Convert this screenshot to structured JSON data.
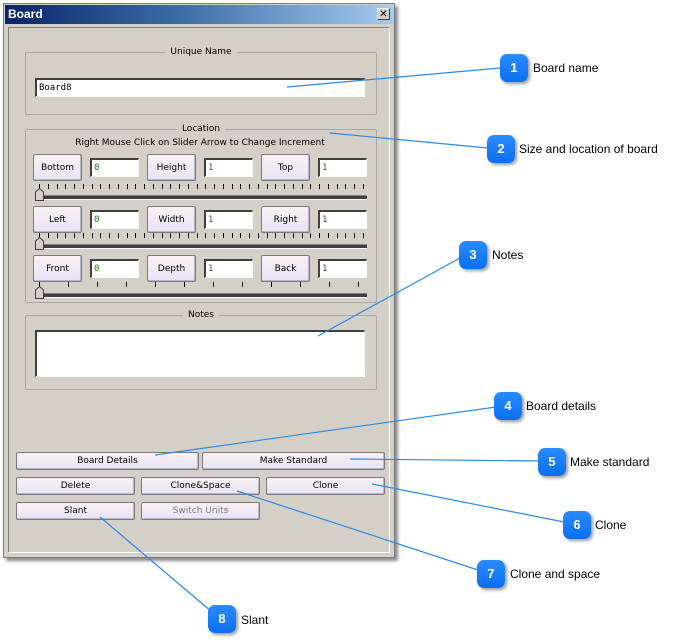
{
  "window": {
    "title": "Board",
    "close_icon": "close-icon"
  },
  "unique_name": {
    "group_label": "Unique Name",
    "value": "Board8"
  },
  "location": {
    "group_label": "Location",
    "hint": "Right Mouse Click on Slider Arrow to Change Increment",
    "rows": [
      {
        "fields": [
          {
            "label": "Bottom",
            "value": "0"
          },
          {
            "label": "Height",
            "value": "1"
          },
          {
            "label": "Top",
            "value": "1"
          }
        ],
        "slider_value": 0
      },
      {
        "fields": [
          {
            "label": "Left",
            "value": "0"
          },
          {
            "label": "Width",
            "value": "1"
          },
          {
            "label": "Right",
            "value": "1"
          }
        ],
        "slider_value": 0
      },
      {
        "fields": [
          {
            "label": "Front",
            "value": "0"
          },
          {
            "label": "Depth",
            "value": "1"
          },
          {
            "label": "Back",
            "value": "1"
          }
        ],
        "slider_value": 0
      }
    ]
  },
  "notes": {
    "group_label": "Notes",
    "value": ""
  },
  "buttons": {
    "board_details": "Board Details",
    "make_standard": "Make Standard",
    "delete": "Delete",
    "clone_space": "Clone&Space",
    "clone": "Clone",
    "slant": "Slant",
    "switch_units": "Switch Units"
  },
  "callouts": [
    {
      "number": "1",
      "text": "Board name"
    },
    {
      "number": "2",
      "text": "Size and location of board"
    },
    {
      "number": "3",
      "text": "Notes"
    },
    {
      "number": "4",
      "text": "Board details"
    },
    {
      "number": "5",
      "text": "Make standard"
    },
    {
      "number": "6",
      "text": "Clone"
    },
    {
      "number": "7",
      "text": "Clone and space"
    },
    {
      "number": "8",
      "text": "Slant"
    }
  ],
  "colors": {
    "callout_badge": "#1a7ef8",
    "callout_line": "#2a8ae8",
    "field_value": "#1a7a1a",
    "titlebar_start": "#0a246a",
    "titlebar_end": "#a6caf0",
    "dialog_bg": "#d4d0c8"
  }
}
